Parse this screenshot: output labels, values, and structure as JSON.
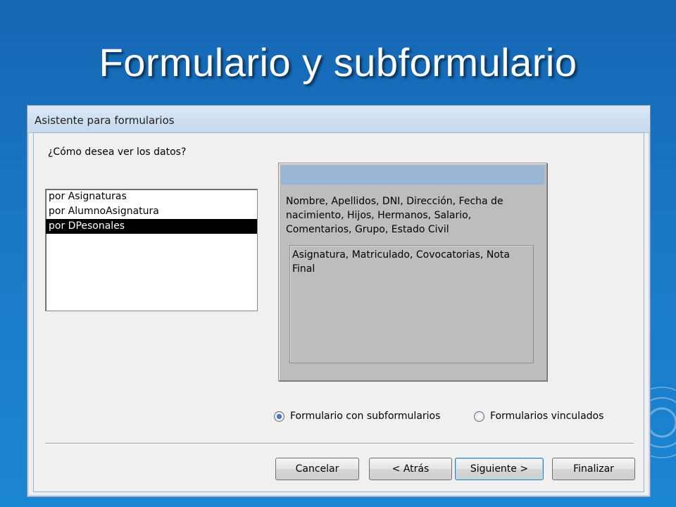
{
  "slide": {
    "title": "Formulario y subformulario"
  },
  "dialog": {
    "title": "Asistente para formularios",
    "question": "¿Cómo desea ver los datos?",
    "view_options": [
      "por Asignaturas",
      "por AlumnoAsignatura",
      "por DPesonales"
    ],
    "selected_view": "por DPesonales",
    "preview": {
      "main_fields": "Nombre, Apellidos, DNI, Dirección, Fecha de nacimiento, Hijos, Hermanos, Salario, Comentarios, Grupo, Estado Civil",
      "sub_fields": "Asignatura, Matriculado, Covocatorias, Nota Final"
    },
    "radio_options": [
      {
        "label": "Formulario con subformularios",
        "checked": true
      },
      {
        "label": "Formularios vinculados",
        "checked": false
      }
    ],
    "buttons": {
      "cancel": "Cancelar",
      "back": "< Atrás",
      "next": "Siguiente >",
      "finish": "Finalizar"
    }
  },
  "colors": {
    "slide_background": "#1a78c6",
    "selection": "#000000",
    "preview_header": "#9bb5d6"
  }
}
